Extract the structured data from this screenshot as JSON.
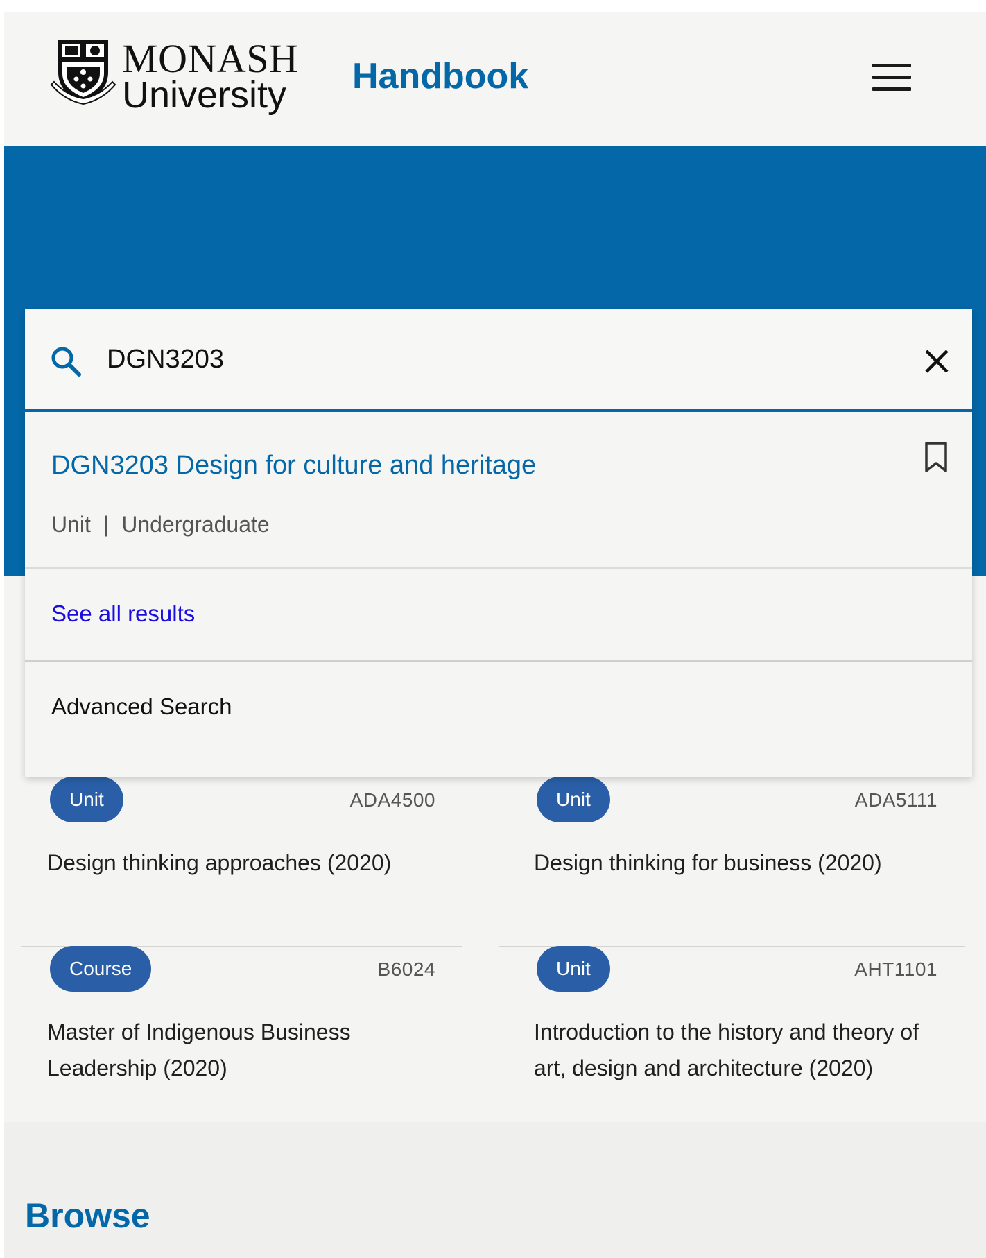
{
  "header": {
    "logo_line1": "MONASH",
    "logo_line2": "University",
    "site_title": "Handbook"
  },
  "search": {
    "query": "DGN3203",
    "result": {
      "code": "DGN3203",
      "title": "Design for culture and heritage",
      "type": "Unit",
      "separator": "|",
      "level": "Undergraduate"
    },
    "see_all_label": "See all results",
    "advanced_label": "Advanced Search"
  },
  "cards": [
    {
      "badge": "Unit",
      "code": "ADA4500",
      "title": "Design thinking approaches (2020)"
    },
    {
      "badge": "Unit",
      "code": "ADA5111",
      "title": "Design thinking for business (2020)"
    },
    {
      "badge": "Course",
      "code": "B6024",
      "title": "Master of Indigenous Business Leadership (2020)"
    },
    {
      "badge": "Unit",
      "code": "AHT1101",
      "title": "Introduction to the history and theory of art, design and architecture (2020)"
    }
  ],
  "browse": {
    "heading": "Browse"
  },
  "colors": {
    "brand_blue": "#0467a8",
    "badge_blue": "#2a5fa8",
    "link_blue": "#1a0dde"
  },
  "icons": [
    "search-icon",
    "close-icon",
    "bookmark-icon",
    "hamburger-menu-icon",
    "monash-crest-logo"
  ]
}
